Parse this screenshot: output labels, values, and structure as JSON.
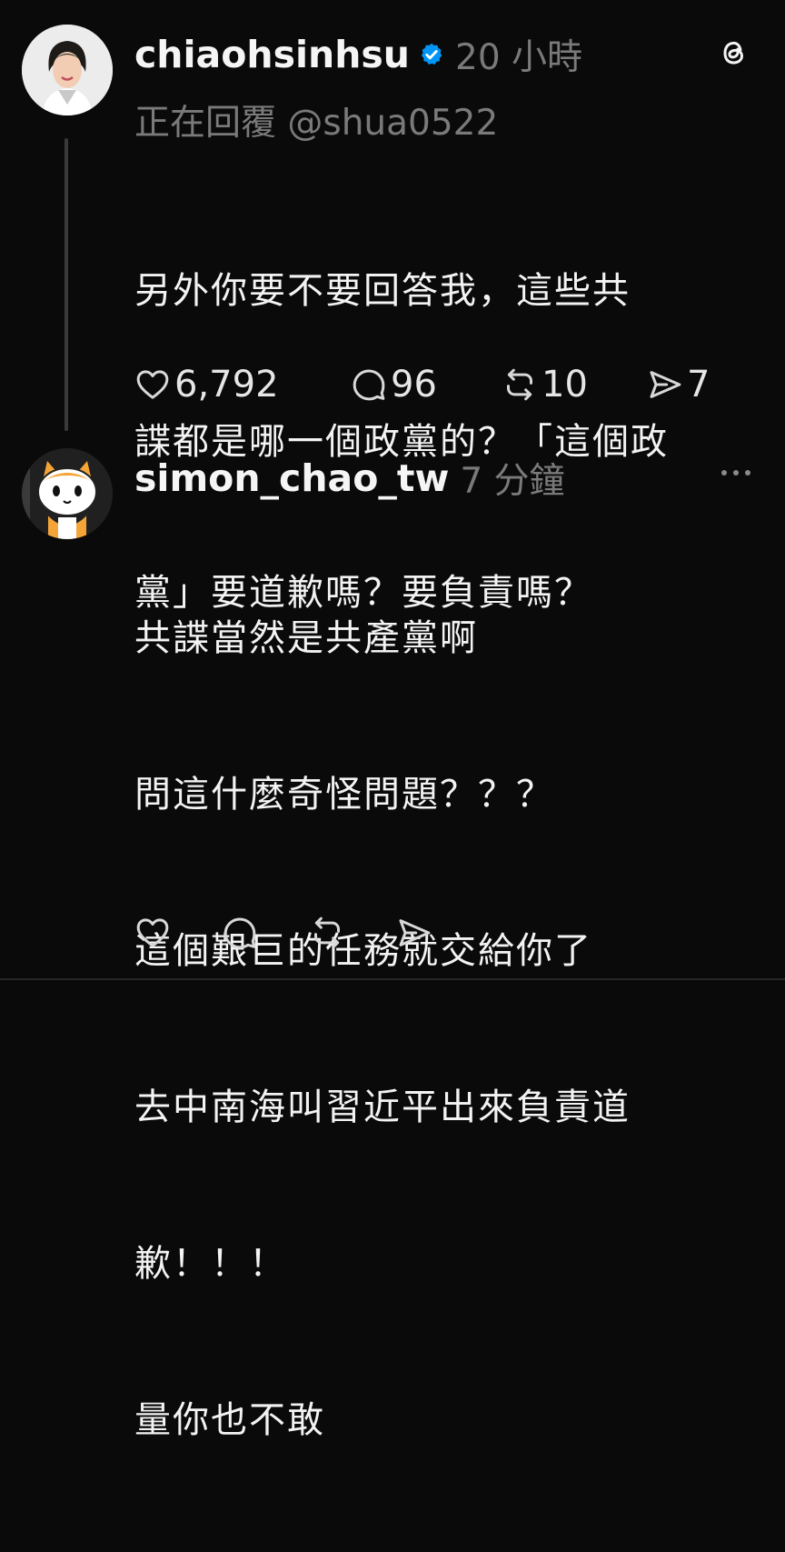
{
  "post1": {
    "username": "chiaohsinhsu",
    "time": "20 小時",
    "reply_to": "正在回覆 @shua0522",
    "lines": [
      "另外你要不要回答我，這些共",
      "諜都是哪一個政黨的？「這個政",
      "黨」要道歉嗎？要負責嗎？"
    ],
    "likes": "6,792",
    "comments": "96",
    "reposts": "10",
    "shares": "7"
  },
  "post2": {
    "username": "simon_chao_tw",
    "time": "7 分鐘",
    "lines": [
      "共諜當然是共產黨啊",
      "問這什麼奇怪問題？？？",
      "這個艱巨的任務就交給你了",
      "去中南海叫習近平出來負責道",
      "歉！！！",
      "量你也不敢"
    ]
  },
  "icons": {
    "app": "threads-icon",
    "verified": "verified-badge-icon",
    "like": "heart-icon",
    "comment": "comment-icon",
    "repost": "repost-icon",
    "share": "send-icon",
    "more": "more-icon"
  },
  "colors": {
    "background": "#0a0a0a",
    "verified": "#0095f6",
    "muted": "#7a7a7a"
  }
}
